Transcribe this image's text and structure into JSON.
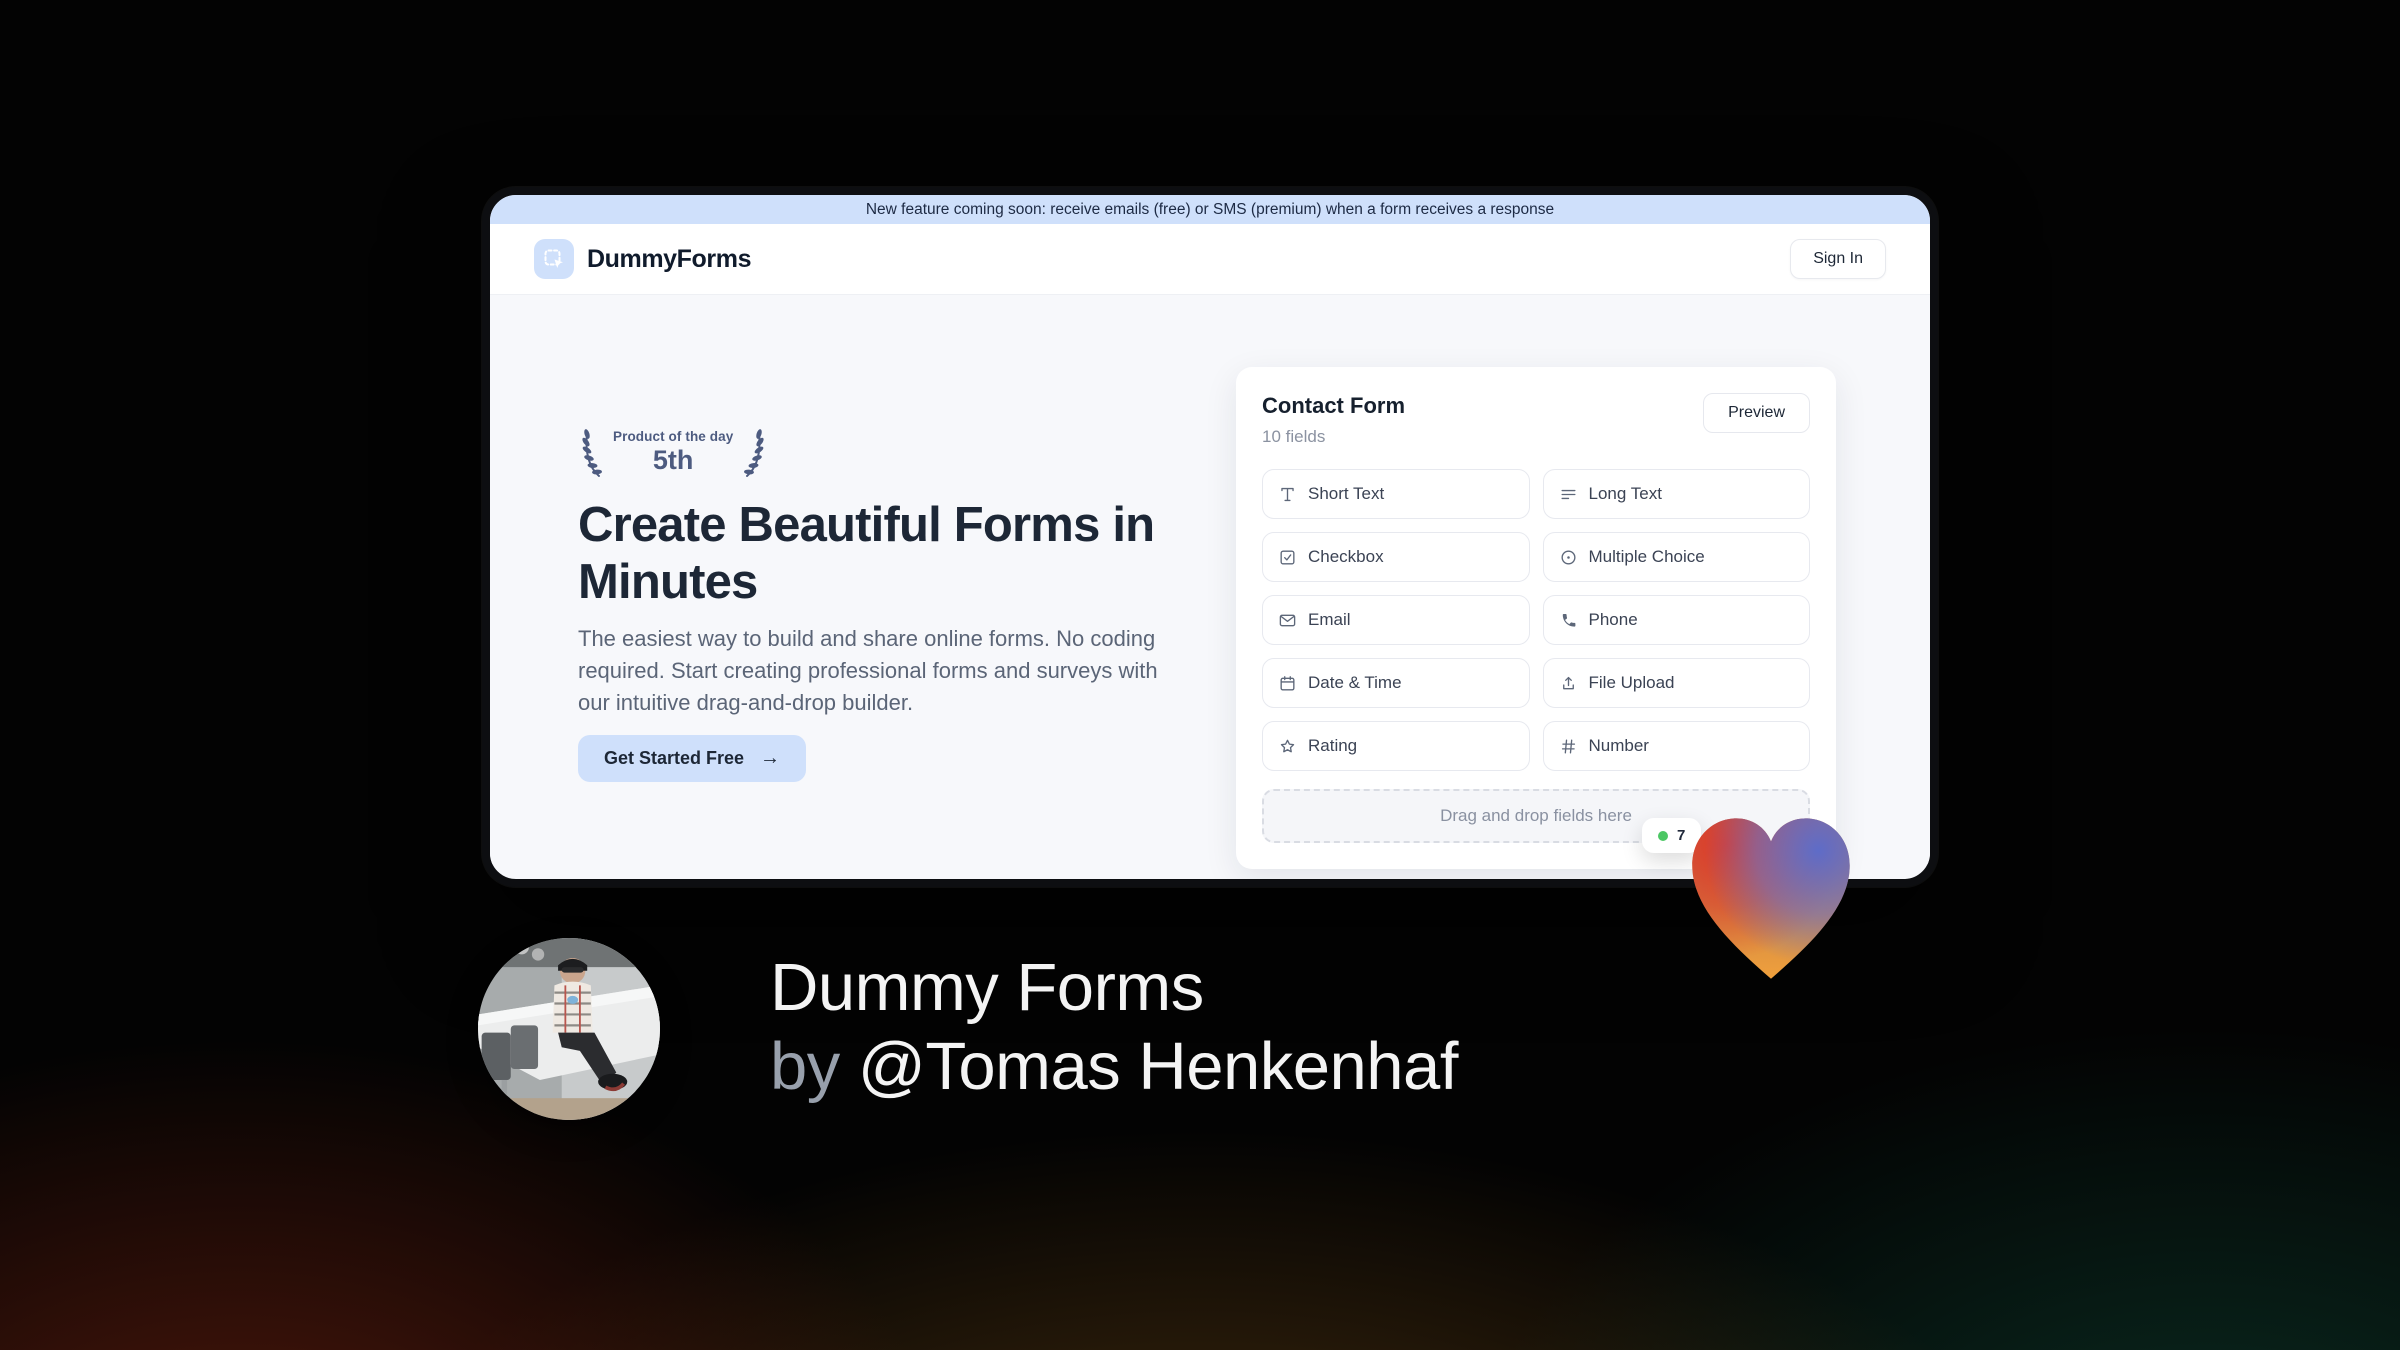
{
  "banner": {
    "text": "New feature coming soon: receive emails (free) or SMS (premium) when a form receives a response"
  },
  "nav": {
    "brand": "DummyForms",
    "sign_in_label": "Sign In"
  },
  "hero": {
    "badge": {
      "line1": "Product of the day",
      "line2": "5th"
    },
    "title": "Create Beautiful Forms in Minutes",
    "description": "The easiest way to build and share online forms. No coding required. Start creating professional forms and surveys with our intuitive drag-and-drop builder.",
    "cta_label": "Get Started Free",
    "cta_arrow": "→"
  },
  "form_card": {
    "title": "Contact Form",
    "subtitle": "10 fields",
    "preview_label": "Preview",
    "fields": [
      {
        "label": "Short Text",
        "icon": "short-text-icon"
      },
      {
        "label": "Long Text",
        "icon": "long-text-icon"
      },
      {
        "label": "Checkbox",
        "icon": "checkbox-icon"
      },
      {
        "label": "Multiple Choice",
        "icon": "multiple-choice-icon"
      },
      {
        "label": "Email",
        "icon": "envelope-icon"
      },
      {
        "label": "Phone",
        "icon": "phone-icon"
      },
      {
        "label": "Date & Time",
        "icon": "calendar-icon"
      },
      {
        "label": "File Upload",
        "icon": "upload-icon"
      },
      {
        "label": "Rating",
        "icon": "star-icon"
      },
      {
        "label": "Number",
        "icon": "hash-icon"
      }
    ],
    "dropzone_text": "Drag and drop fields here",
    "status_badge": {
      "visible_text": "7",
      "dot_color": "#4cc764"
    }
  },
  "caption": {
    "line1": "Dummy Forms",
    "by": "by",
    "author": "@Tomas Henkenhaf"
  },
  "colors": {
    "accent_blue": "#cfe0fb",
    "ink": "#1d2736",
    "muted": "#5b6577",
    "laurel": "#4d5b80",
    "heart_red": "#e03a28",
    "heart_blue": "#5e6cc8",
    "heart_orange": "#f0a03c"
  }
}
